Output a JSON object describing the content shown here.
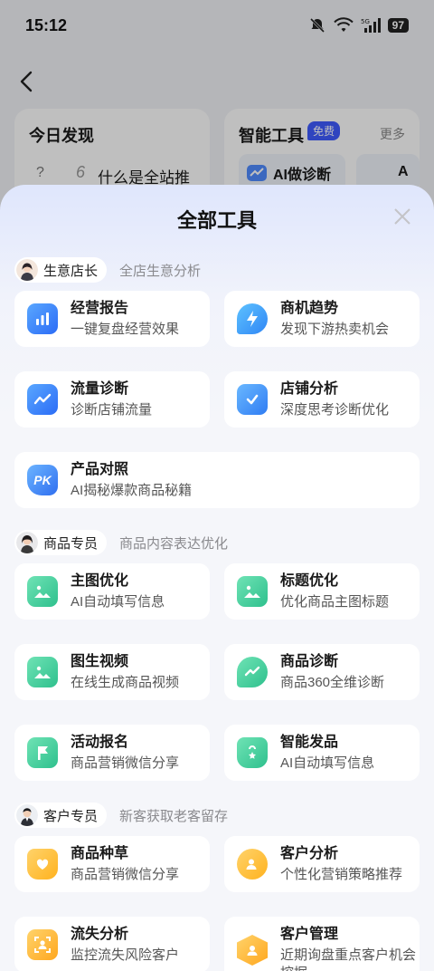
{
  "status": {
    "time": "15:12",
    "battery": "97"
  },
  "background": {
    "card_left_title": "今日发现",
    "card_left_q": "?",
    "card_left_num": "6",
    "card_left_text": "什么是全站推",
    "card_right_title": "智能工具",
    "card_right_badge": "免费",
    "card_right_more": "更多",
    "card_right_chip": "AI做诊断",
    "card_right_chip2": "A"
  },
  "sheet": {
    "title": "全部工具"
  },
  "sections": [
    {
      "name": "生意店长",
      "desc": "全店生意分析",
      "tools": [
        {
          "name": "经营报告",
          "desc": "一键复盘经营效果",
          "icon": "bar-chart-icon"
        },
        {
          "name": "商机趋势",
          "desc": "发现下游热卖机会",
          "icon": "lightning-icon"
        },
        {
          "name": "流量诊断",
          "desc": "诊断店铺流量",
          "icon": "trend-icon"
        },
        {
          "name": "店铺分析",
          "desc": "深度思考诊断优化",
          "icon": "clipboard-check-icon"
        },
        {
          "name": "产品对照",
          "desc": "AI揭秘爆款商品秘籍",
          "icon": "pk-icon",
          "pk": "PK"
        }
      ]
    },
    {
      "name": "商品专员",
      "desc": "商品内容表达优化",
      "tools": [
        {
          "name": "主图优化",
          "desc": "AI自动填写信息",
          "icon": "image-icon"
        },
        {
          "name": "标题优化",
          "desc": "优化商品主图标题",
          "icon": "image-icon"
        },
        {
          "name": "图生视频",
          "desc": "在线生成商品视频",
          "icon": "image-icon"
        },
        {
          "name": "商品诊断",
          "desc": "商品360全维诊断",
          "icon": "chat-trend-icon"
        },
        {
          "name": "活动报名",
          "desc": "商品营销微信分享",
          "icon": "flag-icon"
        },
        {
          "name": "智能发品",
          "desc": "AI自动填写信息",
          "icon": "shopping-bag-icon"
        }
      ]
    },
    {
      "name": "客户专员",
      "desc": "新客获取老客留存",
      "tools": [
        {
          "name": "商品种草",
          "desc": "商品营销微信分享",
          "icon": "heart-bag-icon"
        },
        {
          "name": "客户分析",
          "desc": "个性化营销策略推荐",
          "icon": "user-search-icon"
        },
        {
          "name": "流失分析",
          "desc": "监控流失风险客户",
          "icon": "user-scan-icon"
        },
        {
          "name": "客户管理",
          "desc": "近期询盘重点客户机会挖掘",
          "icon": "user-hex-icon"
        }
      ]
    }
  ]
}
